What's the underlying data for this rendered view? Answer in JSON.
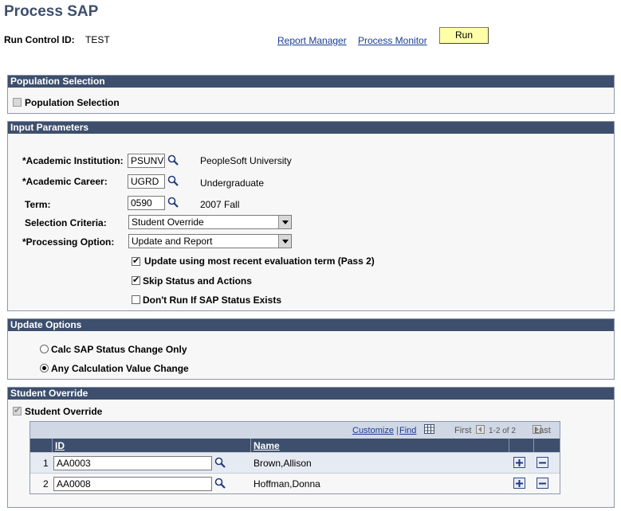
{
  "page": {
    "title": "Process SAP",
    "run_control_label": "Run Control ID:",
    "run_control_value": "TEST",
    "report_manager": "Report Manager",
    "process_monitor": "Process Monitor",
    "run_label": "Run"
  },
  "population": {
    "header": "Population Selection",
    "checkbox_label": "Population Selection",
    "checked": false
  },
  "input": {
    "header": "Input Parameters",
    "institution_label": "*Academic Institution:",
    "institution_value": "PSUNV",
    "institution_desc": "PeopleSoft University",
    "career_label": "*Academic Career:",
    "career_value": "UGRD",
    "career_desc": "Undergraduate",
    "term_label": "Term:",
    "term_value": "0590",
    "term_desc": "2007 Fall",
    "selection_label": "Selection Criteria:",
    "selection_value": "Student Override",
    "processing_label": "*Processing Option:",
    "processing_value": "Update and Report",
    "update_recent_label": "Update using most recent evaluation term (Pass 2)",
    "skip_status_label": "Skip Status and Actions",
    "dont_run_label": "Don't Run If SAP Status Exists"
  },
  "update": {
    "header": "Update Options",
    "calc_only_label": "Calc SAP Status Change Only",
    "any_change_label": "Any Calculation Value Change"
  },
  "override": {
    "header": "Student Override",
    "checkbox_label": "Student Override",
    "grid": {
      "customize": "Customize",
      "find": "Find",
      "first": "First",
      "range": "1-2 of 2",
      "last": "Last",
      "col_id": "ID",
      "col_name": "Name"
    },
    "rows": [
      {
        "num": "1",
        "id": "AA0003",
        "name": "Brown,Allison"
      },
      {
        "num": "2",
        "id": "AA0008",
        "name": "Hoffman,Donna"
      }
    ]
  },
  "colors": {
    "header_bg": "#3d4f6d",
    "run_button_bg": "#ffffa8",
    "link": "#1a3c92"
  }
}
